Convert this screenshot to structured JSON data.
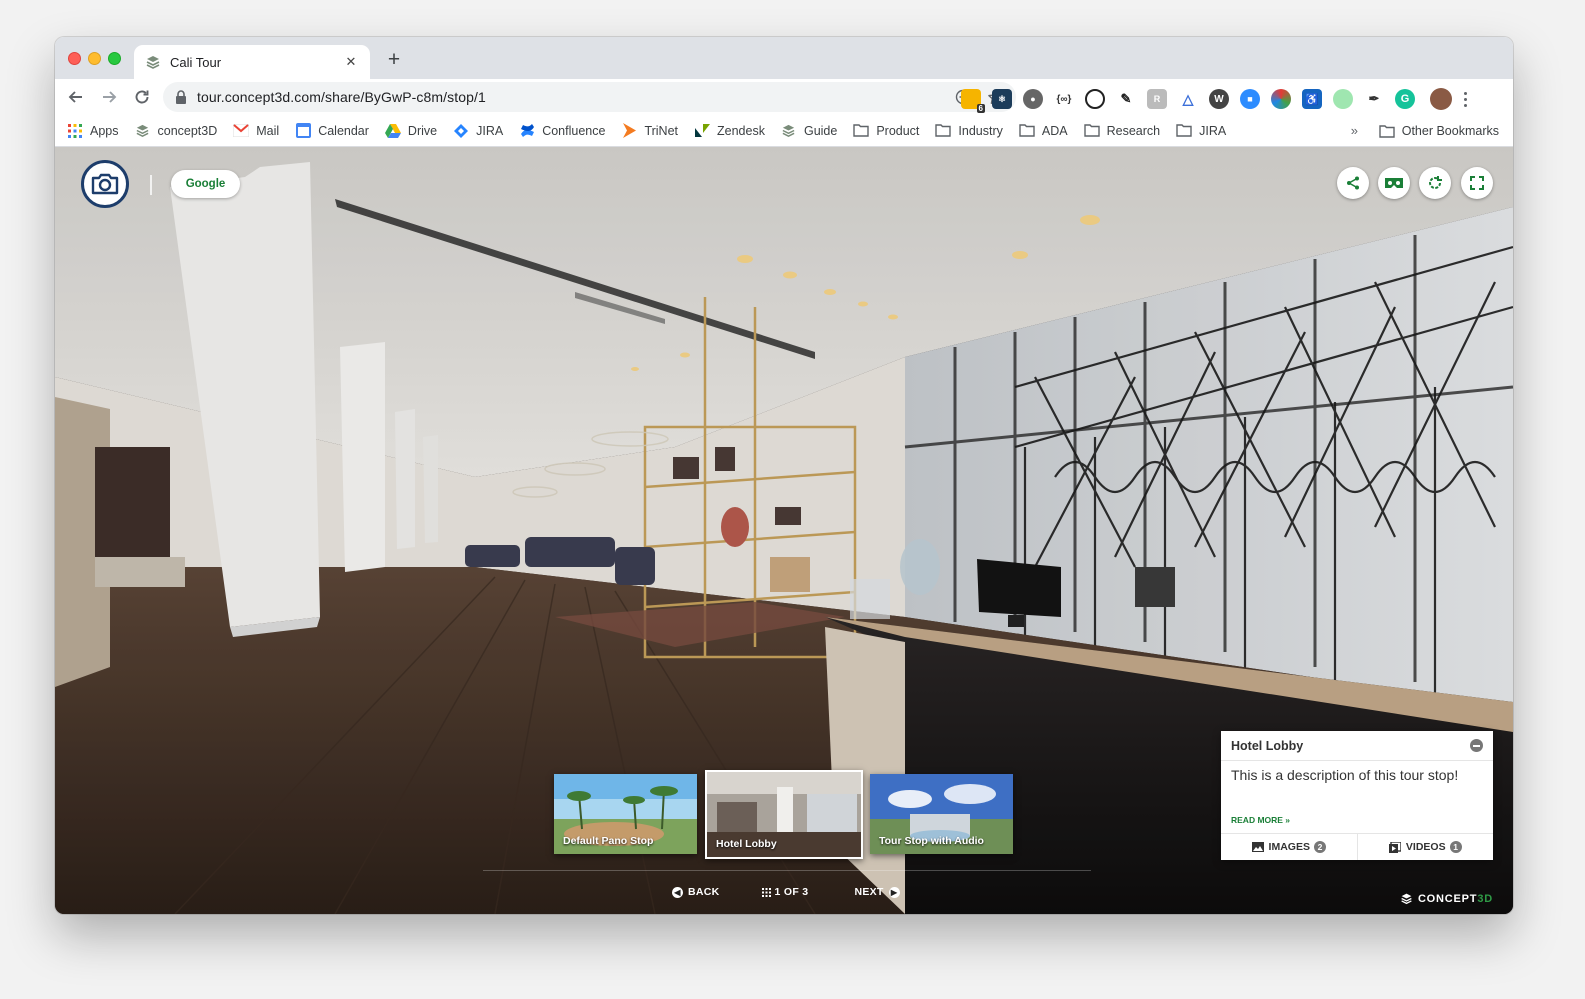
{
  "browser": {
    "tab_title": "Cali Tour",
    "url": "tour.concept3d.com/share/ByGwP-c8m/stop/1",
    "ext_badge": "6"
  },
  "bookmarks": {
    "items": [
      {
        "label": "Apps",
        "icon": "apps-grid-icon"
      },
      {
        "label": "concept3D",
        "icon": "concept3d-icon"
      },
      {
        "label": "Mail",
        "icon": "gmail-icon"
      },
      {
        "label": "Calendar",
        "icon": "calendar-icon"
      },
      {
        "label": "Drive",
        "icon": "drive-icon"
      },
      {
        "label": "JIRA",
        "icon": "jira-icon"
      },
      {
        "label": "Confluence",
        "icon": "confluence-icon"
      },
      {
        "label": "TriNet",
        "icon": "trinet-icon"
      },
      {
        "label": "Zendesk",
        "icon": "zendesk-icon"
      },
      {
        "label": "Guide",
        "icon": "guide-icon"
      },
      {
        "label": "Product",
        "icon": "folder-icon"
      },
      {
        "label": "Industry",
        "icon": "folder-icon"
      },
      {
        "label": "ADA",
        "icon": "folder-icon"
      },
      {
        "label": "Research",
        "icon": "folder-icon"
      },
      {
        "label": "JIRA",
        "icon": "folder-icon"
      }
    ],
    "overflow": "»",
    "other": "Other Bookmarks"
  },
  "tour": {
    "google_label": "Google",
    "thumbnails": [
      {
        "label": "Default Pano Stop",
        "active": false
      },
      {
        "label": "Hotel Lobby",
        "active": true
      },
      {
        "label": "Tour Stop with Audio",
        "active": false
      }
    ],
    "nav": {
      "back": "BACK",
      "counter": "1 OF 3",
      "next": "NEXT"
    },
    "panel": {
      "title": "Hotel Lobby",
      "description": "This is a description of this tour stop!",
      "read_more": "READ MORE »",
      "images_label": "IMAGES",
      "images_count": "2",
      "videos_label": "VIDEOS",
      "videos_count": "1"
    },
    "brand": {
      "main": "CONCEPT",
      "tail": "3D"
    }
  },
  "colors": {
    "brand_green": "#1a7f37",
    "camera_ring": "#1d3d6b"
  }
}
